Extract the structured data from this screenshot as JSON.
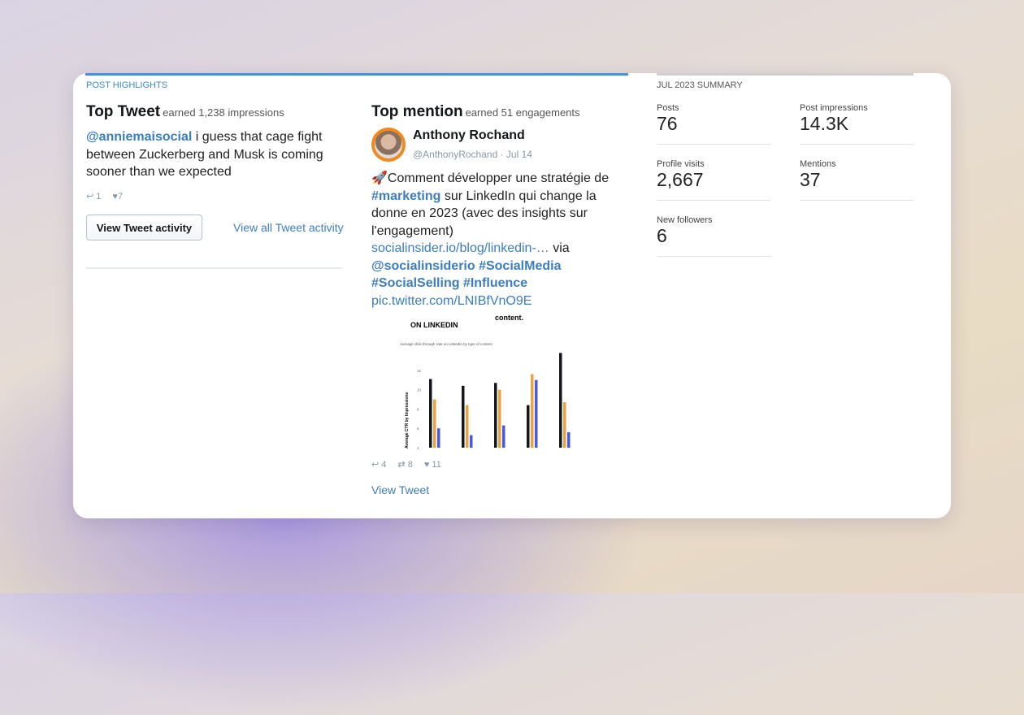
{
  "highlights": {
    "section_label": "POST HIGHLIGHTS",
    "top_tweet": {
      "title": "Top Tweet",
      "earned": "earned 1,238 impressions",
      "mention": "@anniemaisocial",
      "text": " i guess that cage fight between Zuckerberg and Musk is coming sooner than we expected",
      "replies": "1",
      "likes": "7",
      "view_activity_label": "View Tweet activity",
      "view_all_label": "View all Tweet activity"
    },
    "top_mention": {
      "title": "Top mention",
      "earned": "earned 51 engagements",
      "name": "Anthony Rochand",
      "handle": "@AnthonyRochand",
      "date": "· Jul 14",
      "text1": "🚀Comment développer une stratégie de ",
      "tag1": "#marketing",
      "text2": " sur LinkedIn qui change la donne en 2023 (avec des insights sur l'engagement) ",
      "link": "socialinsider.io/blog/linkedin-…",
      "via": " via ",
      "tags": "@socialinsiderio #SocialMedia #SocialSelling #Influence",
      "pic": "pic.twitter.com/LNIBfVnO9E",
      "replies": "4",
      "retweets": "8",
      "likes": "11",
      "view_tweet_label": "View Tweet",
      "image": {
        "heading": "ON LINKEDIN",
        "heading2": "content.",
        "subtitle": "Average click-through rate on LinkedIn by type of content",
        "ylabel": "Average CTR by Impressions",
        "yticks": [
          "4",
          "6",
          "8",
          "10",
          "12"
        ],
        "groups": [
          [
            11.1,
            9,
            6
          ],
          [
            10.4,
            8.4,
            5.3
          ],
          [
            10.7,
            10,
            6.3
          ],
          [
            8.4,
            11.6,
            11
          ],
          [
            13.8,
            8.7,
            5.6
          ]
        ],
        "colors": [
          "#15151c",
          "#f0a040",
          "#4a5ad8"
        ]
      }
    }
  },
  "summary": {
    "section_label": "JUL 2023 SUMMARY",
    "stats": [
      {
        "label": "Posts",
        "value": "76"
      },
      {
        "label": "Post impressions",
        "value": "14.3K"
      },
      {
        "label": "Profile visits",
        "value": "2,667"
      },
      {
        "label": "Mentions",
        "value": "37"
      },
      {
        "label": "New followers",
        "value": "6"
      }
    ]
  }
}
